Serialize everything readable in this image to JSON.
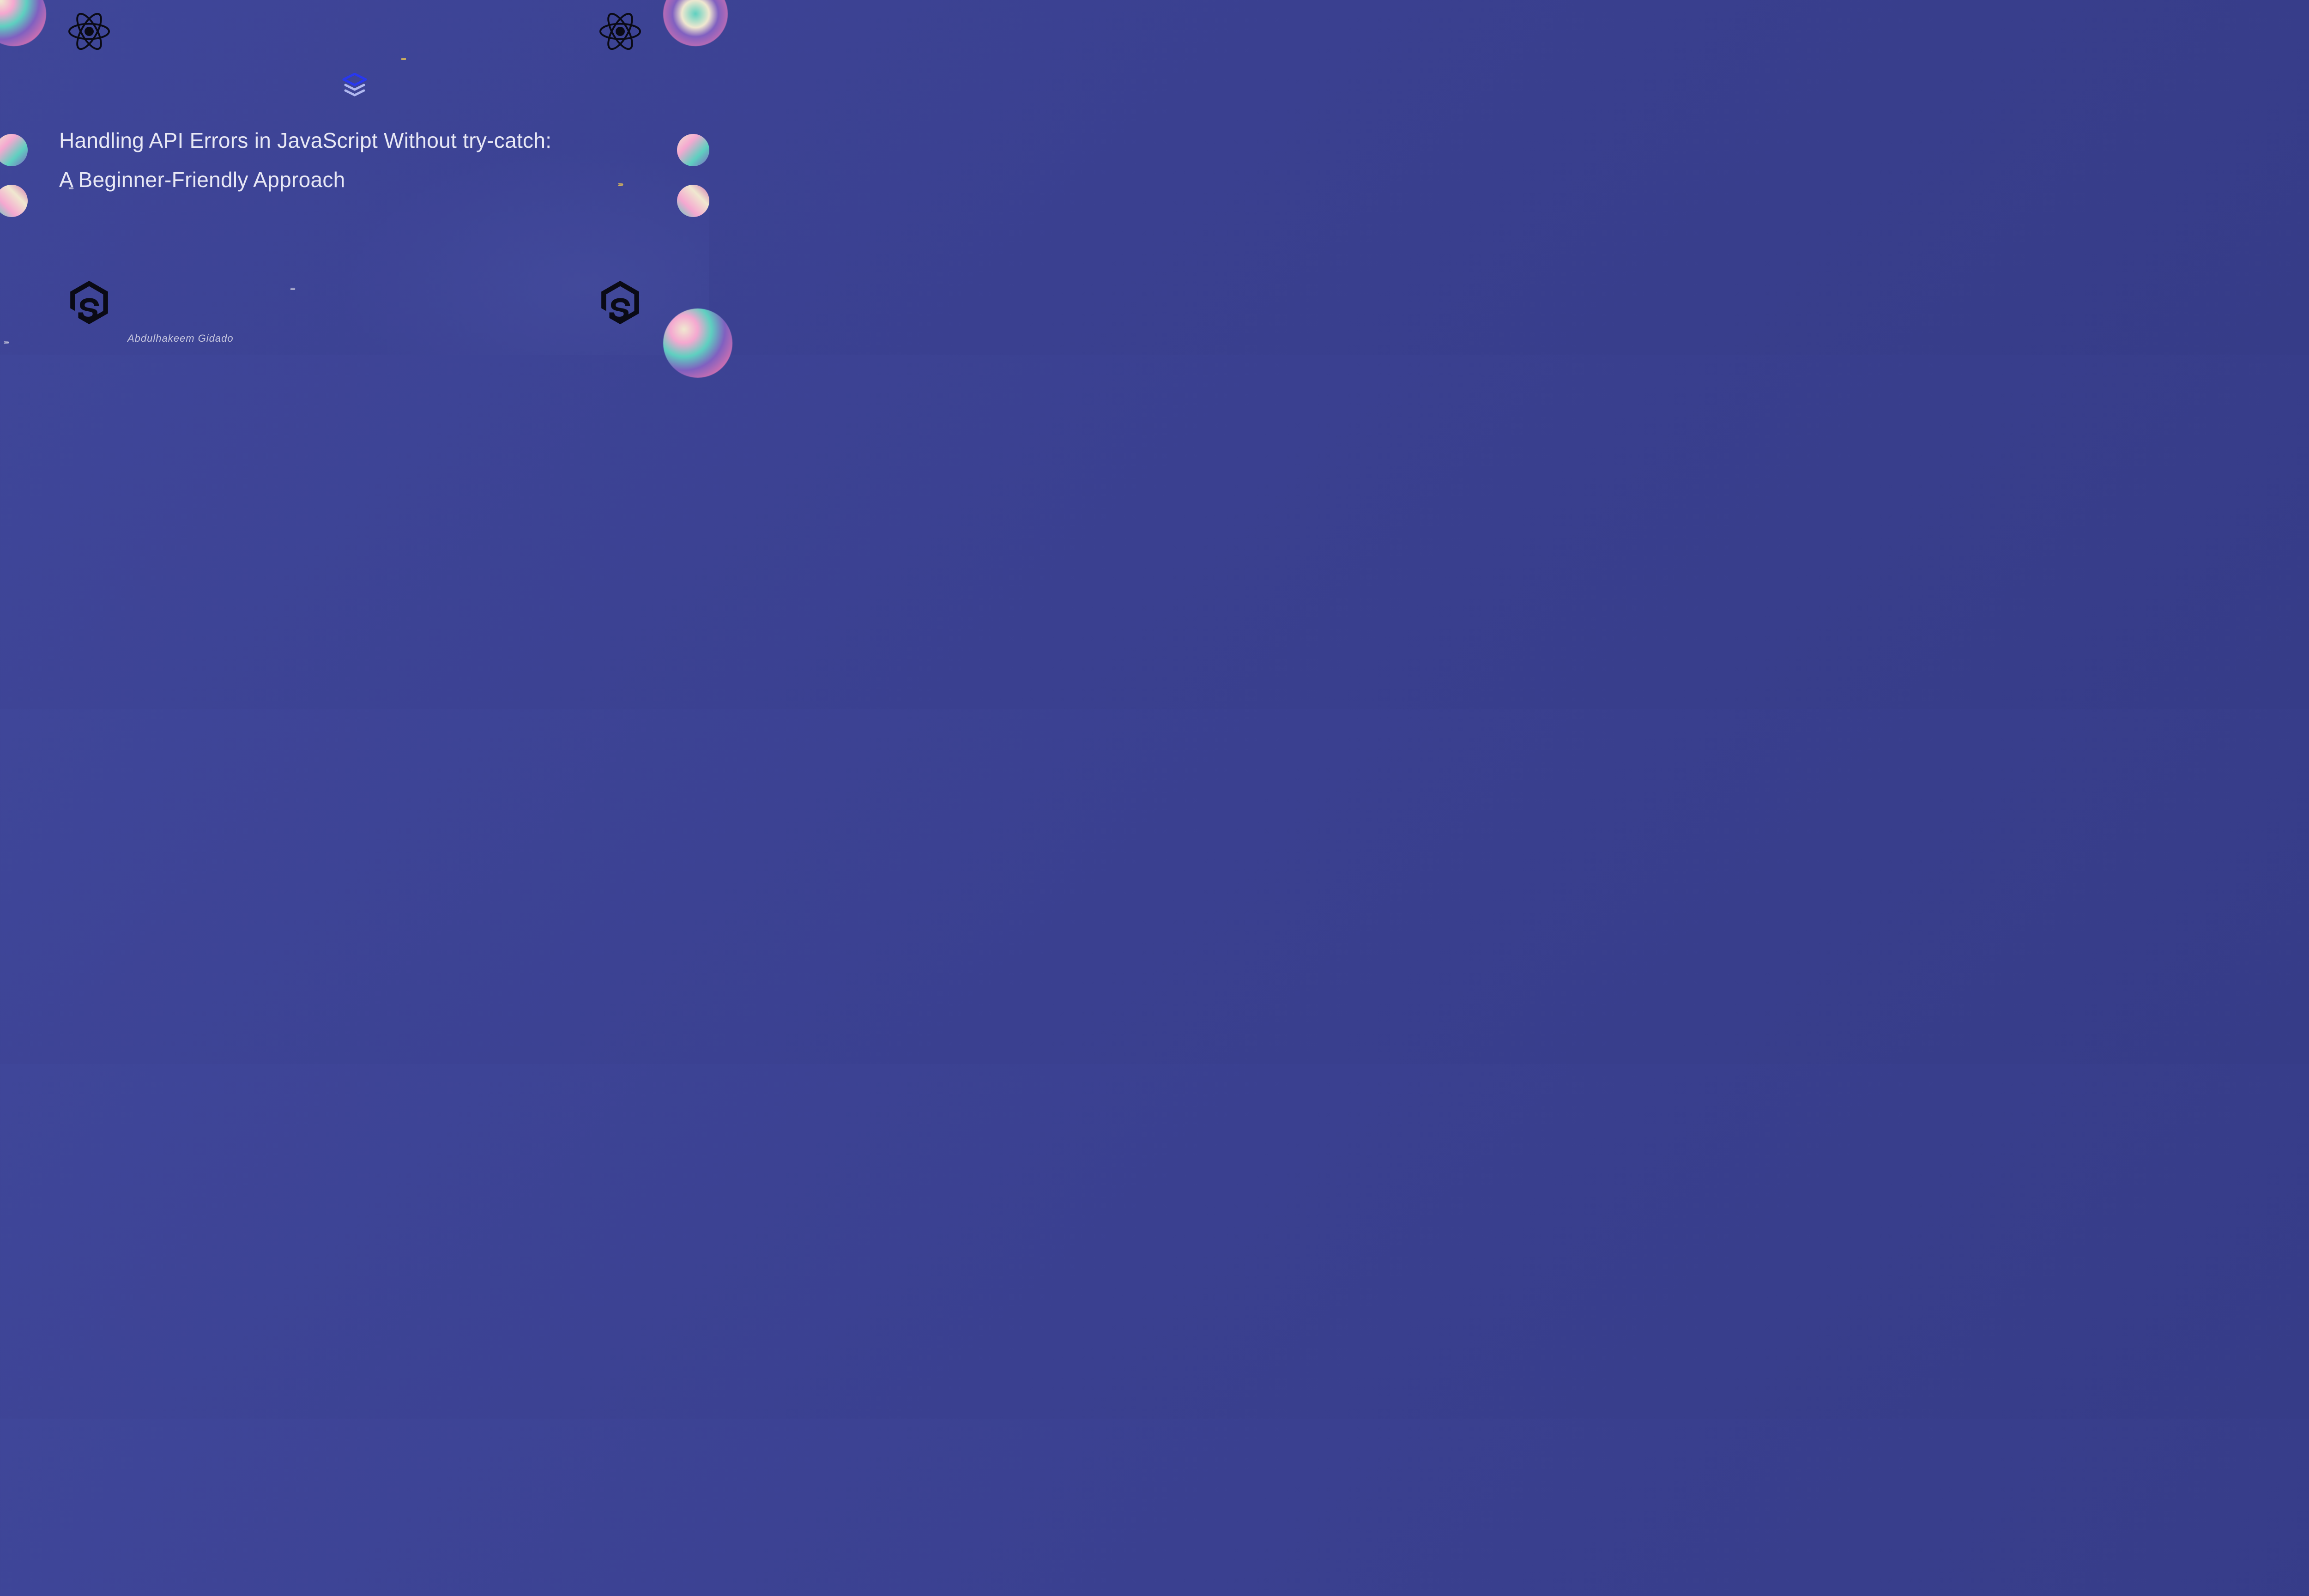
{
  "title_line1": "Handling API Errors in JavaScript Without try-catch:",
  "title_line2": "A Beginner-Friendly Approach",
  "author": "Abdulhakeem  Gidado",
  "chevrons": "›››››",
  "icons": {
    "react": "react-logo",
    "node": "nodejs-logo",
    "stack": "layer-stack-icon",
    "blob": "abstract-blob"
  }
}
